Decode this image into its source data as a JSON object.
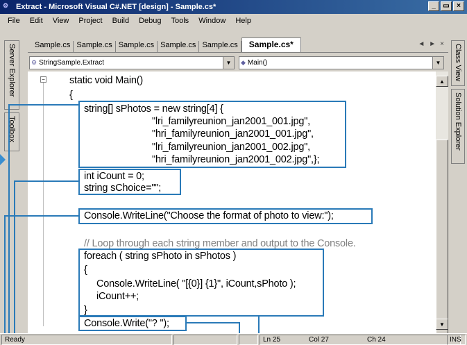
{
  "window": {
    "title": "Extract - Microsoft Visual C#.NET [design] - Sample.cs*",
    "buttons": {
      "minimize": "_",
      "maximize": "Ř",
      "close": "×"
    }
  },
  "menu": [
    "File",
    "Edit",
    "View",
    "Project",
    "Build",
    "Debug",
    "Tools",
    "Window",
    "Help"
  ],
  "left_panel_tabs": [
    "Server Explorer",
    "Toolbox"
  ],
  "right_panel_tabs": [
    "Class View",
    "Solution Explorer"
  ],
  "doc_tabs": [
    "Sample.cs",
    "Sample.cs",
    "Sample.cs",
    "Sample.cs",
    "Sample.cs",
    "Sample.cs*"
  ],
  "tab_nav": {
    "prev": "◄",
    "next": "►",
    "close": "×"
  },
  "combos": {
    "class_selector": "StringSample.Extract",
    "member_selector": "Main()"
  },
  "code_lines": [
    "static void Main()",
    "{",
    "string[] sPhotos = new string[4] {",
    "\"lri_familyreunion_jan2001_001.jpg\",",
    "\"hri_familyreunion_jan2001_001.jpg\",",
    "\"lri_familyreunion_jan2001_002.jpg\",",
    "\"hri_familyreunion_jan2001_002.jpg\",};",
    "int iCount = 0;",
    "string sChoice=\"\";",
    "Console.WriteLine(\"Choose the format of photo to view:\");",
    "// Loop through each string member and output to the Console.",
    "foreach ( string sPhoto in sPhotos )",
    "{",
    "Console.WriteLine( \"[{0}] {1}\", iCount,sPhoto );",
    "iCount++;",
    "}",
    "Console.Write(\"? \");"
  ],
  "status": {
    "ready": "Ready",
    "line": "Ln 25",
    "col": "Col 27",
    "ch": "Ch 24",
    "mode": "INS"
  },
  "colors": {
    "highlight": "#2a7ab8",
    "titlebar": "#0a246a",
    "comment": "#808080"
  }
}
